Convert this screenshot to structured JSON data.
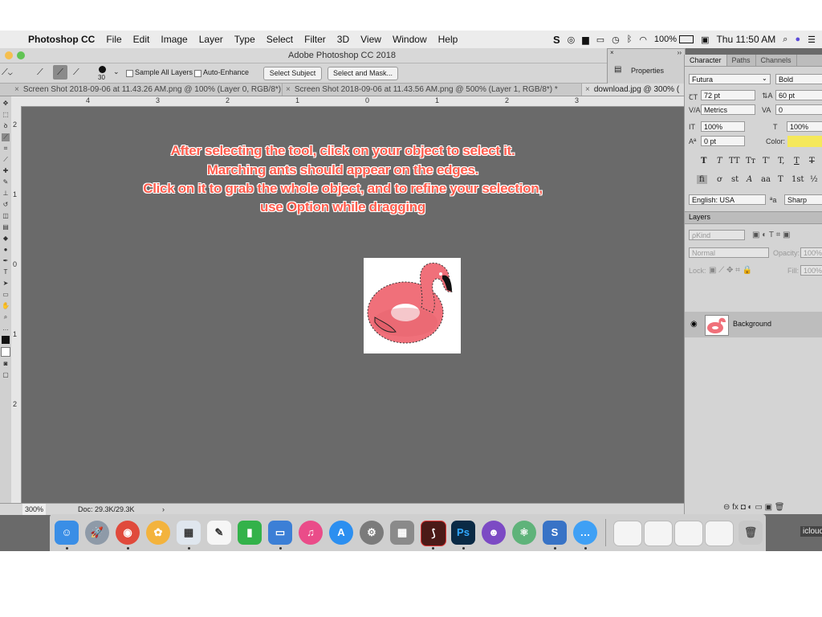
{
  "menubar": {
    "app_name": "Photoshop CC",
    "items": [
      "File",
      "Edit",
      "Image",
      "Layer",
      "Type",
      "Select",
      "Filter",
      "3D",
      "View",
      "Window",
      "Help"
    ],
    "battery": "100%",
    "clock": "Thu 11:50 AM"
  },
  "window": {
    "title": "Adobe Photoshop CC 2018"
  },
  "options": {
    "brush_size": "30",
    "sample_all_layers": "Sample All Layers",
    "auto_enhance": "Auto-Enhance",
    "select_subject": "Select Subject",
    "select_and_mask": "Select and Mask..."
  },
  "tabs": [
    "Screen Shot 2018-09-06 at 11.43.26 AM.png @ 100% (Layer 0, RGB/8*)",
    "Screen Shot 2018-09-06 at 11.43.56 AM.png @ 500% (Layer 1, RGB/8*) *",
    "download.jpg @ 300% ("
  ],
  "ruler": {
    "h": [
      "4",
      "3",
      "2",
      "1",
      "0",
      "1",
      "2",
      "3"
    ],
    "v": [
      "2",
      "1",
      "0",
      "1",
      "2"
    ]
  },
  "instructions": [
    "After selecting the tool, click on your object to select it.",
    "Marching ants should appear on the edges.",
    "Click on it to grab the whole object, and to refine your selection,",
    "use Option while dragging"
  ],
  "status": {
    "zoom": "300%",
    "doc": "Doc: 29.3K/29.3K"
  },
  "properties": {
    "label": "Properties"
  },
  "character": {
    "tabs": [
      "Character",
      "Paths",
      "Channels"
    ],
    "font_family": "Futura",
    "font_style": "Bold",
    "size": "72 pt",
    "leading": "60 pt",
    "kerning": "Metrics",
    "tracking": "0",
    "vscale": "100%",
    "hscale": "100%",
    "baseline": "0 pt",
    "color_label": "Color:",
    "color_value": "#f5e85a",
    "language": "English: USA",
    "aa_label": "ªa",
    "antialias": "Sharp"
  },
  "layers": {
    "title": "Layers",
    "filter": "ρKind",
    "blend": "Normal",
    "opacity_label": "Opacity:",
    "opacity": "100%",
    "lock_label": "Lock:",
    "fill_label": "Fill:",
    "fill": "100%",
    "layer_name": "Background"
  },
  "dock": {
    "icloud": "icloud"
  },
  "colors": {
    "accent": "#ff5c4d",
    "canvas": "#6a6a6a",
    "flamingo": "#f0707a"
  }
}
